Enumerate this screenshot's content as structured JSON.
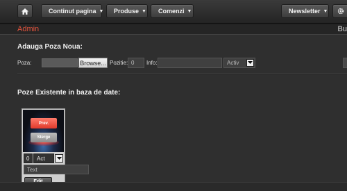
{
  "topbar": {
    "home_icon": "home-icon",
    "continut_label": "Continut pagina",
    "produse_label": "Produse",
    "comenzi_label": "Comenzi",
    "newsletter_label": "Newsletter"
  },
  "admin": {
    "title": "Admin",
    "right_text": "Bu"
  },
  "add_form": {
    "title": "Adauga Poza Noua:",
    "poza_label": "Poza:",
    "browse_label": "Browse...",
    "pozitie_label": "Pozitie:",
    "pozitie_value": "0",
    "info_label": "Info:",
    "info_value": "",
    "status_value": "Activ"
  },
  "existing": {
    "title": "Poze Existente in baza de date:",
    "items": [
      {
        "prev_label": "Prev.",
        "sterge_label": "Sterge",
        "position": "0",
        "status": "Act",
        "text_placeholder": "Text",
        "edit_label": "Edit"
      }
    ]
  }
}
